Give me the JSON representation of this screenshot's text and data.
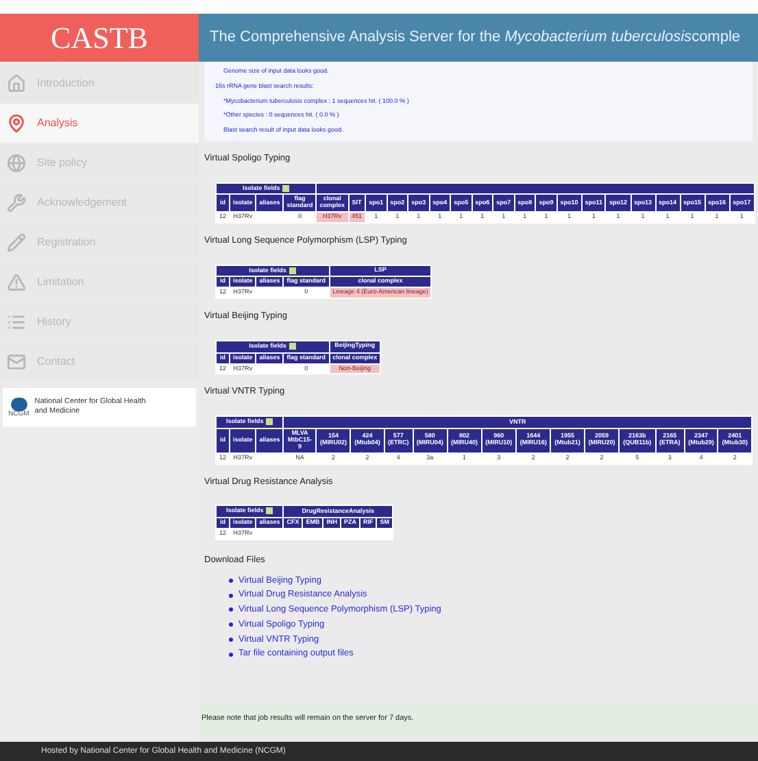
{
  "header": {
    "logo": "CASTB",
    "title_before": "The Comprehensive Analysis Server for the ",
    "title_italic": "Mycobacterium tuberculosis",
    "title_after": " comple"
  },
  "sidebar": {
    "items": [
      {
        "label": "Introduction",
        "selected": false
      },
      {
        "label": "Analysis",
        "selected": true
      },
      {
        "label": "Site policy",
        "selected": false
      },
      {
        "label": "Acknowledgement",
        "selected": false
      },
      {
        "label": "Registration",
        "selected": false
      },
      {
        "label": "Limitation",
        "selected": false
      },
      {
        "label": "History",
        "selected": false
      },
      {
        "label": "Contact",
        "selected": false
      }
    ],
    "sponsor": {
      "name": "National Center for Global Health and Medicine",
      "logo_text": "NCGM"
    }
  },
  "messages": [
    {
      "text": "Genome size of input data looks good.",
      "indent": true
    },
    {
      "text": "16s rRNA gene blast search results:",
      "indent": false
    },
    {
      "text": "*Mycobacterium tuberculosis complex : 1 sequences hit. ( 100.0 % )",
      "indent": true
    },
    {
      "text": "*Other species : 0 sequences hit. ( 0.0 % )",
      "indent": true
    },
    {
      "text": "Blast search result of input data looks good.",
      "indent": true
    }
  ],
  "sections": [
    {
      "title": "Virtual Spoligo Typing",
      "table": {
        "groups": [
          {
            "label": "Isolate fields",
            "toggle": true,
            "columns": [
              "id",
              "isolate",
              "aliases",
              "flag standard"
            ]
          },
          {
            "toggle": false,
            "columns": [
              "clonal complex",
              "SIT",
              "spo1",
              "spo2",
              "spo3",
              "spo4",
              "spo5",
              "spo6",
              "spo7",
              "spo8",
              "spo9",
              "spo10",
              "spo11",
              "spo12",
              "spo13",
              "spo14",
              "spo15",
              "spo16",
              "spo17"
            ]
          }
        ],
        "rows": [
          [
            {
              "text": "12",
              "highlighted": false
            },
            {
              "text": "H37Rv",
              "highlighted": false
            },
            {
              "highlighted": false
            },
            {
              "text": "0",
              "highlighted": false
            },
            {
              "text": "H37Rv",
              "highlighted": true
            },
            {
              "text": "451",
              "highlighted": true
            },
            {
              "text": "1",
              "highlighted": false
            },
            {
              "text": "1",
              "highlighted": false
            },
            {
              "text": "1",
              "highlighted": false
            },
            {
              "text": "1",
              "highlighted": false
            },
            {
              "text": "1",
              "highlighted": false
            },
            {
              "text": "1",
              "highlighted": false
            },
            {
              "text": "1",
              "highlighted": false
            },
            {
              "text": "1",
              "highlighted": false
            },
            {
              "text": "1",
              "highlighted": false
            },
            {
              "text": "1",
              "highlighted": false
            },
            {
              "text": "1",
              "highlighted": false
            },
            {
              "text": "1",
              "highlighted": false
            },
            {
              "text": "1",
              "highlighted": false
            },
            {
              "text": "1",
              "highlighted": false
            },
            {
              "text": "1",
              "highlighted": false
            },
            {
              "text": "1",
              "highlighted": false
            },
            {
              "text": "1",
              "highlighted": false
            }
          ]
        ]
      }
    },
    {
      "title": "Virtual Long Sequence Polymorphism (LSP) Typing",
      "table": {
        "groups": [
          {
            "label": "Isolate fields",
            "toggle": true,
            "columns": [
              "id",
              "isolate",
              "aliases",
              "flag standard"
            ]
          },
          {
            "label": "LSP",
            "toggle": false,
            "columns": [
              "clonal complex"
            ]
          }
        ],
        "rows": [
          [
            {
              "text": "12",
              "highlighted": false
            },
            {
              "text": "H37Rv",
              "highlighted": false
            },
            {
              "highlighted": false
            },
            {
              "text": "0",
              "highlighted": false
            },
            {
              "text": "Lineage 4 (Euro-American lineage)",
              "highlighted": true
            }
          ]
        ]
      }
    },
    {
      "title": "Virtual Beijing Typing",
      "table": {
        "groups": [
          {
            "label": "Isolate fields",
            "toggle": true,
            "columns": [
              "id",
              "isolate",
              "aliases",
              "flag standard"
            ]
          },
          {
            "label": "BeijingTyping",
            "toggle": false,
            "columns": [
              "clonal complex"
            ]
          }
        ],
        "rows": [
          [
            {
              "text": "12",
              "highlighted": false
            },
            {
              "text": "H37Rv",
              "highlighted": false
            },
            {
              "highlighted": false
            },
            {
              "text": "0",
              "highlighted": false
            },
            {
              "text": "Non-Beijing",
              "highlighted": true
            }
          ]
        ]
      }
    },
    {
      "title": "Virtual VNTR Typing",
      "table": {
        "groups": [
          {
            "label": "Isolate fields",
            "toggle": true,
            "columns": [
              "id",
              "isolate",
              "aliases"
            ]
          },
          {
            "label": "VNTR",
            "toggle": false,
            "columns": [
              "MLVA MtbC15-9",
              "154 (MIRU02)",
              "424 (Mtub04)",
              "577 (ETRC)",
              "580 (MIRU04)",
              "802 (MIRU40)",
              "960 (MIRU10)",
              "1644 (MIRU16)",
              "1955 (Mtub21)",
              "2059 (MIRU20)",
              "2163b (QUB11b)",
              "2165 (ETRA)",
              "2347 (Mtub29)",
              "2401 (Mtub30)"
            ]
          }
        ],
        "rows": [
          [
            {
              "text": "12",
              "highlighted": false
            },
            {
              "text": "H37Rv",
              "highlighted": false
            },
            {
              "highlighted": false
            },
            {
              "text": "NA",
              "highlighted": false
            },
            {
              "text": "2",
              "highlighted": false
            },
            {
              "text": "2",
              "highlighted": false
            },
            {
              "text": "4",
              "highlighted": false
            },
            {
              "text": "3a",
              "highlighted": false
            },
            {
              "text": "1",
              "highlighted": false
            },
            {
              "text": "3",
              "highlighted": false
            },
            {
              "text": "2",
              "highlighted": false
            },
            {
              "text": "2",
              "highlighted": false
            },
            {
              "text": "2",
              "highlighted": false
            },
            {
              "text": "5",
              "highlighted": false
            },
            {
              "text": "3",
              "highlighted": false
            },
            {
              "text": "4",
              "highlighted": false
            },
            {
              "text": "2",
              "highlighted": false
            }
          ]
        ]
      }
    },
    {
      "title": "Virtual Drug Resistance Analysis",
      "table": {
        "groups": [
          {
            "label": "Isolate fields",
            "toggle": true,
            "columns": [
              "id",
              "isolate",
              "aliases"
            ]
          },
          {
            "label": "DrugResistanceAnalysis",
            "toggle": false,
            "columns": [
              "CFX",
              "EMB",
              "INH",
              "PZA",
              "RIF",
              "SM"
            ]
          }
        ],
        "rows": [
          [
            {
              "text": "12",
              "highlighted": false
            },
            {
              "text": "H37Rv",
              "highlighted": false
            },
            {
              "highlighted": false
            },
            {
              "highlighted": false
            },
            {
              "highlighted": false
            },
            {
              "highlighted": false
            },
            {
              "highlighted": false
            },
            {
              "highlighted": false
            },
            {
              "highlighted": false
            }
          ]
        ]
      }
    }
  ],
  "downloads": {
    "title": "Download Files",
    "links": [
      "Virtual Beijing Typing",
      "Virtual Drug Resistance Analysis",
      "Virtual Long Sequence Polymorphism (LSP) Typing",
      "Virtual Spoligo Typing",
      "Virtual VNTR Typing",
      "Tar file containing output files"
    ]
  },
  "note": "Please note that job results will remain on the server for 7 days.",
  "footer": "Hosted by National Center for Global Health and Medicine (NCGM)"
}
